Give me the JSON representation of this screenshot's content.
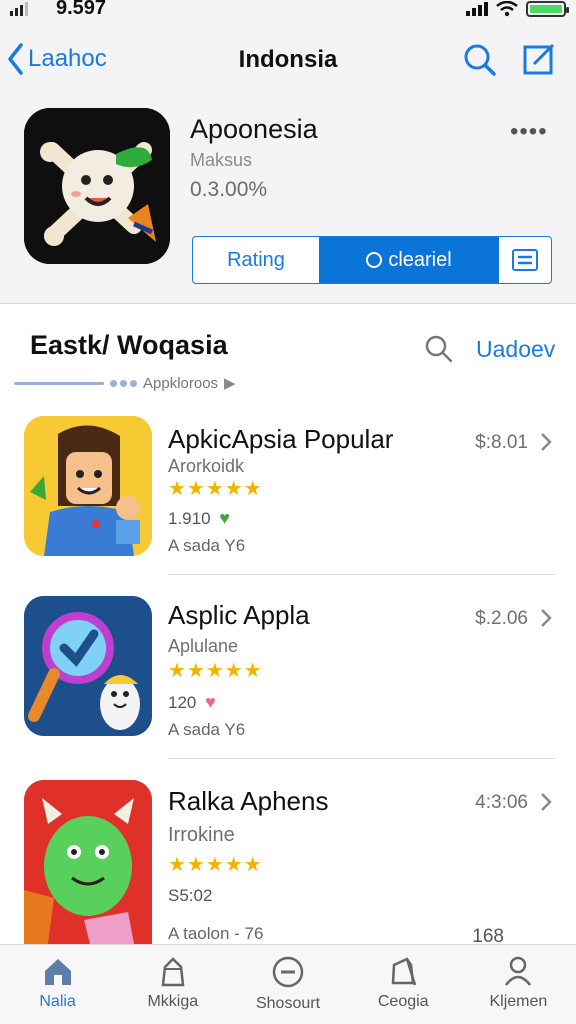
{
  "status_bar": {
    "time": "9.597"
  },
  "nav": {
    "back_label": "Laahoc",
    "title": "Indonsia"
  },
  "app": {
    "name": "Apoonesia",
    "subtitle": "Maksus",
    "price": "0.3.00%",
    "segments": {
      "rating": "Rating",
      "cleared": "cleariel"
    }
  },
  "section": {
    "title": "Eastk/ Woqasia",
    "link": "Uadoev",
    "sub": "Appkloroos"
  },
  "apps": [
    {
      "title": "ApkicApsia Popular",
      "subtitle": "Arorkoidk",
      "stars": "★★★★★",
      "count": "1.910",
      "meta": "A sada  Y6",
      "price": "$:8.01",
      "extra": ""
    },
    {
      "title": "Asplic Appla",
      "subtitle": "Aplulane",
      "stars": "★★★★★",
      "count": "120",
      "meta": "A sada  Y6",
      "price": "$.2.06",
      "extra": ""
    },
    {
      "title": "Ralka Aphens",
      "subtitle": "Irrokine",
      "stars": "★★★★★",
      "count": "S5:02",
      "meta": "A taolon - 76",
      "price": "4:3:06",
      "extra": "168"
    }
  ],
  "tabs": [
    {
      "label": "Nalia",
      "icon": "home-icon",
      "active": true
    },
    {
      "label": "Mkkiga",
      "icon": "bag-icon",
      "active": false
    },
    {
      "label": "Shosourt",
      "icon": "chat-icon",
      "active": false
    },
    {
      "label": "Ceogia",
      "icon": "bag-icon",
      "active": false
    },
    {
      "label": "Kljemen",
      "icon": "person-icon",
      "active": false
    }
  ],
  "colors": {
    "accent": "#1a7ae0",
    "star": "#f2b400",
    "segment_active": "#0a74d8"
  }
}
